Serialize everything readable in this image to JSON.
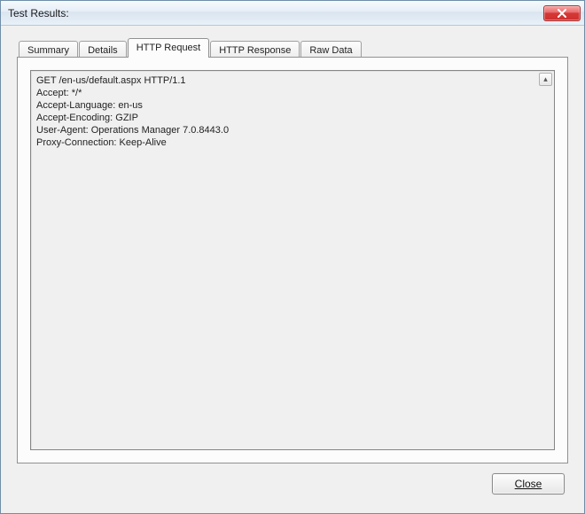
{
  "window": {
    "title": "Test Results:"
  },
  "tabs": [
    {
      "label": "Summary",
      "active": false
    },
    {
      "label": "Details",
      "active": false
    },
    {
      "label": "HTTP Request",
      "active": true
    },
    {
      "label": "HTTP Response",
      "active": false
    },
    {
      "label": "Raw Data",
      "active": false
    }
  ],
  "content": {
    "http_request_text": "GET /en-us/default.aspx HTTP/1.1\nAccept: */*\nAccept-Language: en-us\nAccept-Encoding: GZIP\nUser-Agent: Operations Manager 7.0.8443.0\nProxy-Connection: Keep-Alive"
  },
  "buttons": {
    "close": "Close"
  }
}
